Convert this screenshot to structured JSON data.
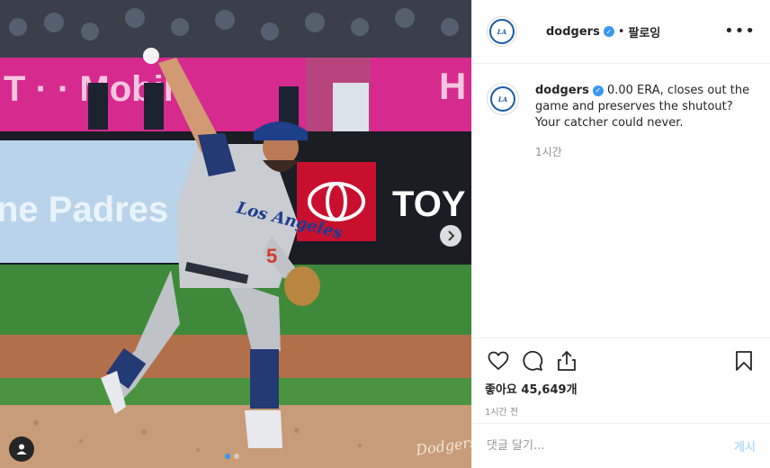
{
  "post": {
    "username": "dodgers",
    "follow_label": "팔로잉",
    "separator": "•",
    "more_icon": "more-options-icon",
    "caption": "0.00 ERA, closes out the game and preserves the shutout? Your catcher could never.",
    "caption_time": "1시간",
    "likes": "좋아요 45,649개",
    "posted": "1시간 전",
    "comment_placeholder": "댓글 달기...",
    "post_label": "게시"
  },
  "photo": {
    "banner_left": "T · · Mobile",
    "banner_right": "H",
    "board_text": "ne Padres",
    "sponsor": "TOY",
    "jersey_text": "Los Angeles",
    "jersey_number": "5",
    "watermark": "Dodgers",
    "slide_count": 2,
    "active_slide": 1
  },
  "colors": {
    "accent": "#3897f0",
    "brand_blue": "#1a5aa6",
    "tmobile_magenta": "#d62a8e",
    "toyota_red": "#c8102e"
  }
}
